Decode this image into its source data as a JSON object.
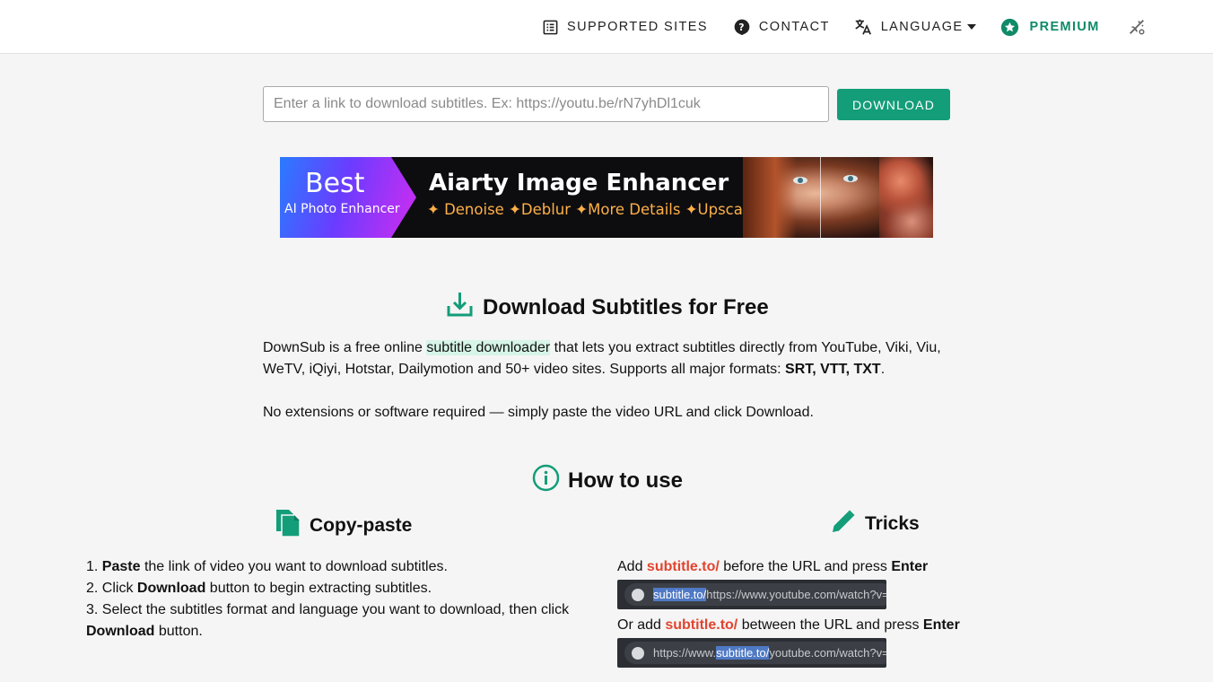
{
  "nav": {
    "supported_sites": "SUPPORTED SITES",
    "contact": "CONTACT",
    "language": "LANGUAGE",
    "premium": "PREMIUM"
  },
  "search": {
    "placeholder": "Enter a link to download subtitles. Ex: https://youtu.be/rN7yhDl1cuk",
    "button": "DOWNLOAD"
  },
  "banner": {
    "best": "Best",
    "sub": "AI Photo Enhancer",
    "title": "Aiarty Image Enhancer",
    "features": "✦ Denoise  ✦Deblur  ✦More Details  ✦Upscale"
  },
  "intro": {
    "heading": "Download Subtitles for Free",
    "p1_a": "DownSub is a free online ",
    "p1_link": "subtitle downloader",
    "p1_b": " that lets you extract subtitles directly from YouTube, Viki, Viu, WeTV, iQiyi, Hotstar, Dailymotion and 50+ video sites. Supports all major formats: ",
    "p1_formats": "SRT, VTT, TXT",
    "p1_end": ".",
    "p2": "No extensions or software required — simply paste the video URL and click Download."
  },
  "howto": {
    "heading": "How to use",
    "copy_heading": "Copy-paste",
    "tricks_heading": "Tricks",
    "step1_num": "1. ",
    "step1_bold": "Paste",
    "step1_rest": " the link of video you want to download subtitles.",
    "step2_num": "2. Click ",
    "step2_bold": "Download",
    "step2_rest": " button to begin extracting subtitles.",
    "step3_text": "3. Select the subtitles format and language you want to download, then click ",
    "step3_bold": "Download",
    "step3_rest": " button.",
    "trick1_a": "Add ",
    "trick1_red": "subtitle.to/",
    "trick1_b": " before the URL and press ",
    "trick1_bold": "Enter",
    "trick1_url_sel": "subtitle.to/",
    "trick1_url_rest": "https://www.youtube.com/watch?v=",
    "trick2_a": "Or add ",
    "trick2_red": "subtitle.to/",
    "trick2_b": " between the URL and press ",
    "trick2_bold": "Enter",
    "trick2_url_pre": "https://www.",
    "trick2_url_sel": "subtitle.to/",
    "trick2_url_rest": "youtube.com/watch?v="
  },
  "colors": {
    "accent": "#139d79",
    "premium": "#0f8a68",
    "highlight": "#e2442f"
  }
}
